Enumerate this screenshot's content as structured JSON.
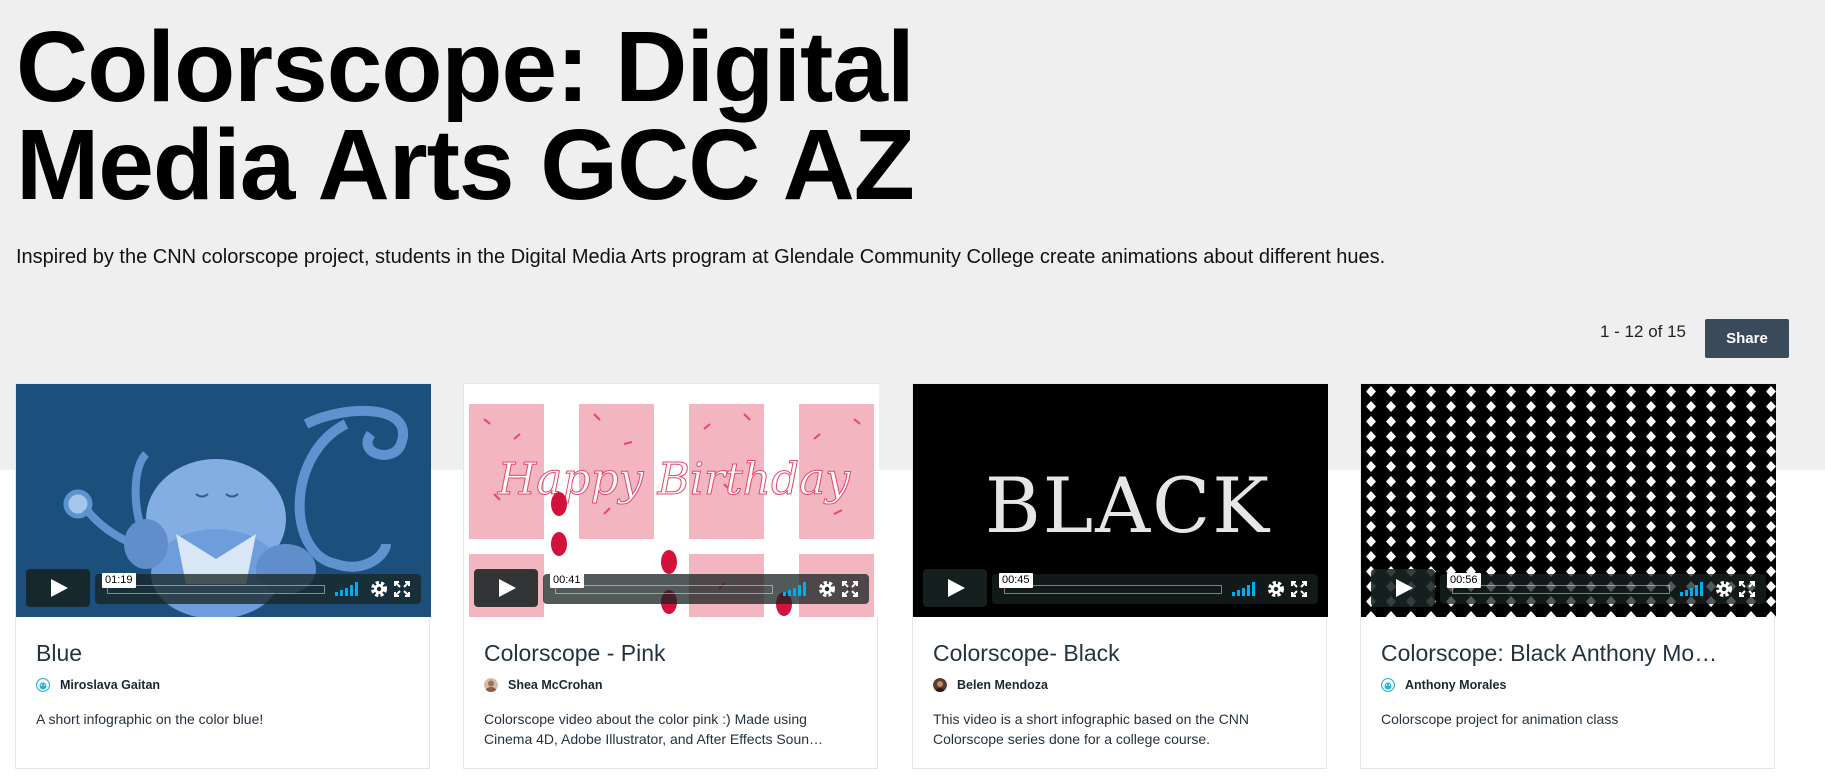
{
  "header": {
    "title": "Colorscope: Digital Media Arts GCC AZ",
    "description": "Inspired by the CNN colorscope project, students in the Digital Media Arts program at Glendale Community College create animations about different hues."
  },
  "toolbar": {
    "pagination": "1 - 12 of 15",
    "share_label": "Share"
  },
  "videos": [
    {
      "title": "Blue",
      "author": "Miroslava Gaitan",
      "description": "A short infographic on the color blue!",
      "duration": "01:19",
      "thumb_text": ""
    },
    {
      "title": "Colorscope - Pink",
      "author": "Shea McCrohan",
      "description": "Colorscope video about the color pink :) Made using Cinema 4D, Adobe Illustrator, and After Effects Soun…",
      "duration": "00:41",
      "thumb_text": "Happy Birthday"
    },
    {
      "title": "Colorscope- Black",
      "author": "Belen Mendoza",
      "description": "This video is a short infographic based on the CNN Colorscope series done for a college course.",
      "duration": "00:45",
      "thumb_text": "BLACK"
    },
    {
      "title": "Colorscope: Black Anthony Mo…",
      "author": "Anthony Morales",
      "description": "Colorscope project for animation class",
      "duration": "00:56",
      "thumb_text": ""
    }
  ],
  "icons": [
    "play-icon",
    "volume-icon",
    "gear-icon",
    "fullscreen-icon",
    "avatar"
  ],
  "colors": {
    "hero_background": "#efefef",
    "share_button": "#3a4a5a",
    "volume_accent": "#00adef",
    "blue_thumb": "#1d4f7c",
    "pink_thumb": "#f3b5bf"
  }
}
